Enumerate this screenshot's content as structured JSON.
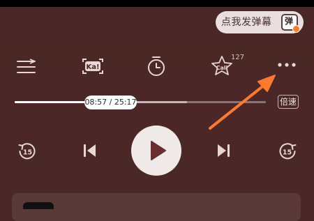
{
  "danmaku": {
    "prompt": "点我发弹幕",
    "toggle_glyph": "弹"
  },
  "toolbar": {
    "call_count": "127"
  },
  "player": {
    "time_display": "08:57 / 25:17",
    "speed_label": "倍速",
    "rewind_seconds": "15",
    "forward_seconds": "15",
    "progress_fraction": 0.28
  },
  "icons": {
    "playlist": "playlist-icon",
    "karaoke": "karaoke-icon",
    "timer": "timer-icon",
    "call": "call-icon",
    "more": "more-icon",
    "rewind": "rewind-15-icon",
    "previous": "previous-icon",
    "play": "play-icon",
    "next": "next-icon",
    "forward": "forward-15-icon"
  },
  "colors": {
    "background": "#4b2827",
    "accent_arrow": "#ff7a2f",
    "play_button": "#efe9e8"
  }
}
